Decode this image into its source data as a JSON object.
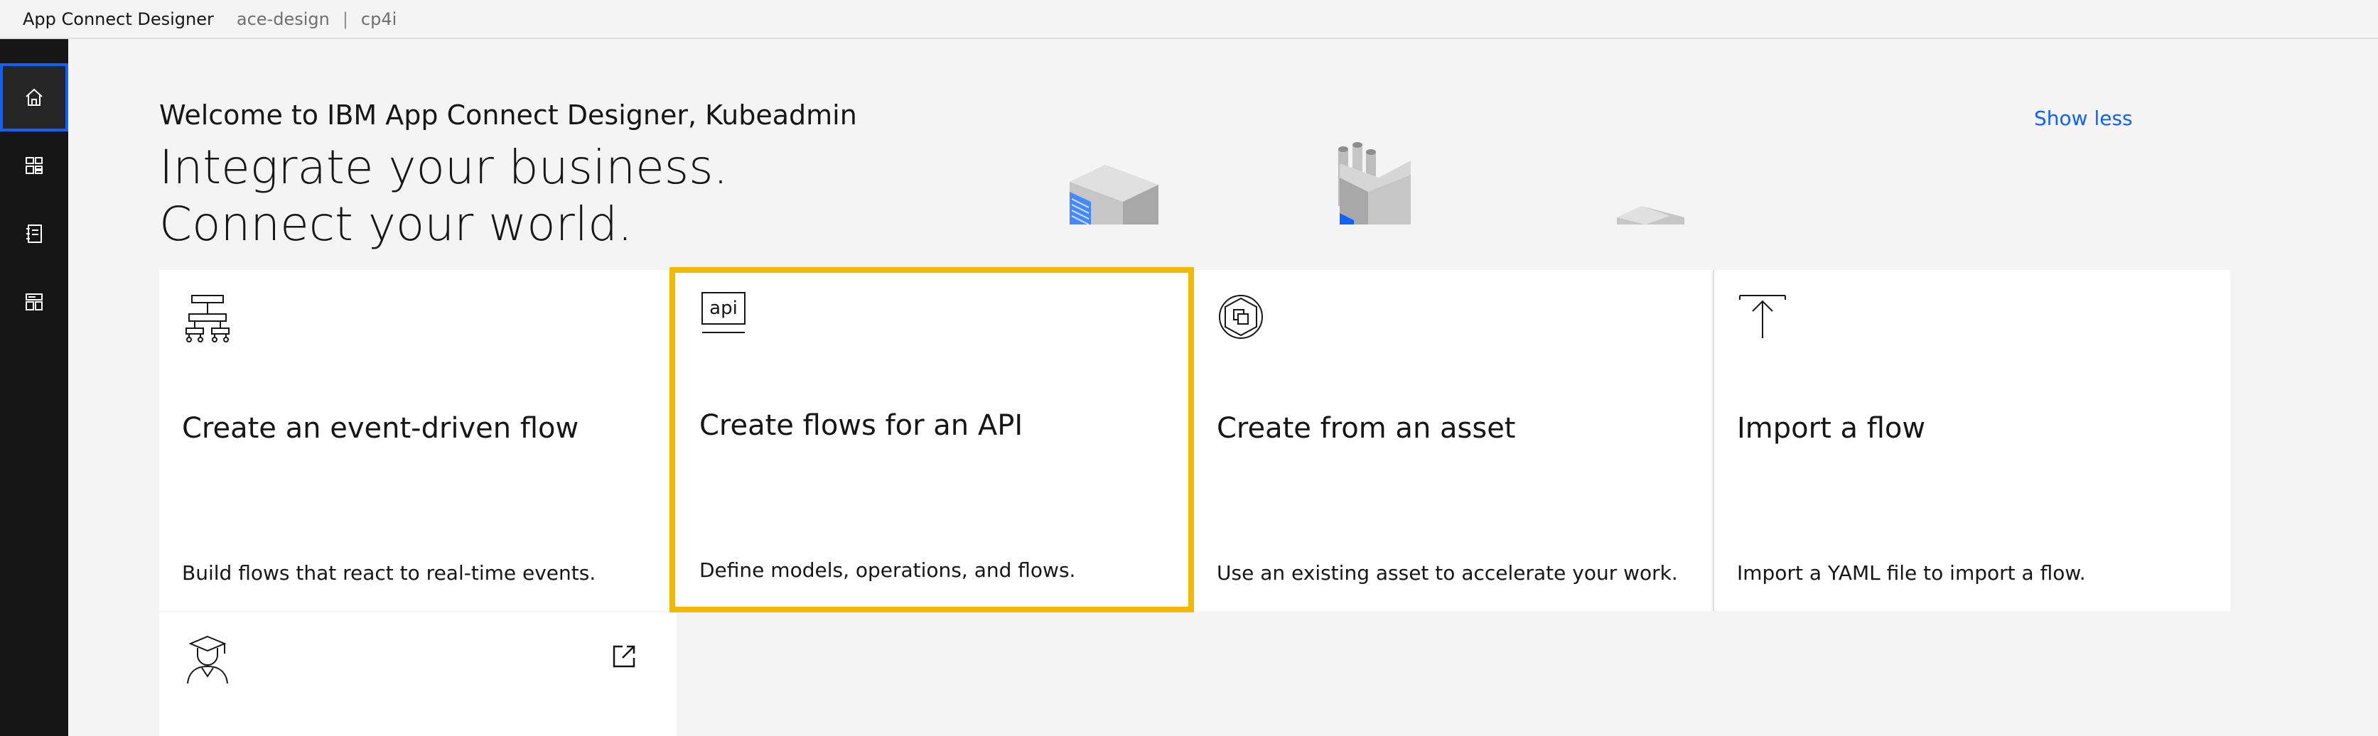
{
  "header": {
    "product_name": "App Connect Designer",
    "namespace": "ace-design",
    "separator": "|",
    "instance": "cp4i"
  },
  "nav": {
    "items": [
      {
        "icon": "home-icon",
        "active": true
      },
      {
        "icon": "dashboard-icon",
        "active": false
      },
      {
        "icon": "catalog-icon",
        "active": false
      },
      {
        "icon": "template-icon",
        "active": false
      }
    ]
  },
  "hero": {
    "welcome": "Welcome to IBM App Connect Designer, Kubeadmin",
    "headline": "Integrate your business. Connect your world.",
    "show_less": "Show less"
  },
  "tiles": [
    {
      "icon": "event-flow-icon",
      "title": "Create an event-driven flow",
      "description": "Build flows that react to real-time events.",
      "selected": false
    },
    {
      "icon": "api-icon",
      "title": "Create flows for an API",
      "icon_text": "api",
      "description": "Define models, operations, and flows.",
      "selected": true
    },
    {
      "icon": "asset-icon",
      "title": "Create from an asset",
      "description": "Use an existing asset to accelerate your work.",
      "selected": false
    },
    {
      "icon": "upload-icon",
      "title": "Import a flow",
      "description": "Import a YAML file to import a flow.",
      "selected": false
    },
    {
      "icon": "learner-icon",
      "title": "",
      "description": "",
      "launch_icon": "launch-icon",
      "selected": false
    }
  ],
  "colors": {
    "accent": "#0f62fe",
    "selection": "#f5b800",
    "rail": "#161616",
    "background": "#f4f4f4"
  }
}
